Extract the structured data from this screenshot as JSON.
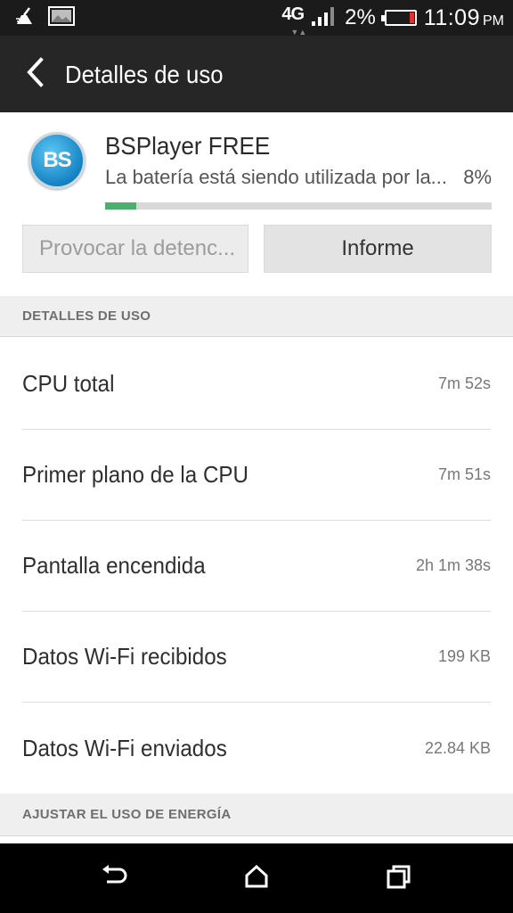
{
  "status_bar": {
    "network_type": "4G",
    "battery_percent": "2%",
    "time": "11:09",
    "time_suffix": "PM",
    "icons": [
      "cleaner-icon",
      "image-icon",
      "signal-icon",
      "battery-low-icon"
    ]
  },
  "app_bar": {
    "title": "Detalles de uso",
    "back_icon": "chevron-left-icon"
  },
  "app": {
    "name": "BSPlayer FREE",
    "icon_text": "BS",
    "usage_description": "La batería está siendo utilizada por la...",
    "usage_percent_label": "8%",
    "usage_fraction": 0.08,
    "bar_color": "#4caf6d"
  },
  "buttons": {
    "force_stop_label": "Provocar la detenc...",
    "report_label": "Informe"
  },
  "sections": {
    "usage_details_header": "DETALLES DE USO",
    "adjust_power_header": "AJUSTAR EL USO DE ENERGÍA"
  },
  "usage_rows": [
    {
      "label": "CPU total",
      "value": "7m 52s"
    },
    {
      "label": "Primer plano de la CPU",
      "value": "7m 51s"
    },
    {
      "label": "Pantalla encendida",
      "value": "2h 1m 38s"
    },
    {
      "label": "Datos Wi-Fi recibidos",
      "value": "199 KB"
    },
    {
      "label": "Datos Wi-Fi enviados",
      "value": "22.84 KB"
    }
  ],
  "nav_bar": {
    "icons": [
      "back-icon",
      "home-icon",
      "recents-icon"
    ]
  }
}
